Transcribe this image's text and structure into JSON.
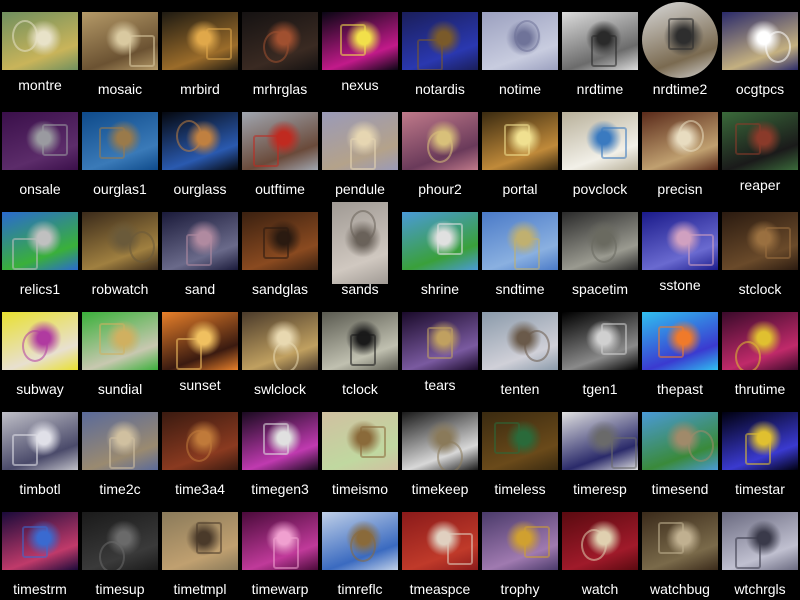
{
  "gallery": {
    "items": [
      {
        "name": "montre",
        "colors": [
          "#6f8f5e",
          "#c9b45a",
          "#e8e2c8"
        ],
        "label_high": true
      },
      {
        "name": "mosaic",
        "colors": [
          "#b59a68",
          "#6b5232",
          "#d9c9a0"
        ]
      },
      {
        "name": "mrbird",
        "colors": [
          "#1e1a12",
          "#9b6c2a",
          "#e0a84a"
        ]
      },
      {
        "name": "mrhrglas",
        "colors": [
          "#151212",
          "#3a2a22",
          "#a05030"
        ]
      },
      {
        "name": "nexus",
        "colors": [
          "#0a0614",
          "#c21a8a",
          "#f2e04a"
        ],
        "label_high": true
      },
      {
        "name": "notardis",
        "colors": [
          "#1a1e5a",
          "#2a38b0",
          "#7a5a2a"
        ]
      },
      {
        "name": "notime",
        "colors": [
          "#9ba0bf",
          "#c8ccdf",
          "#6f7399"
        ]
      },
      {
        "name": "nrdtime",
        "colors": [
          "#dcdcdc",
          "#6b6b6b",
          "#2a2a2a"
        ]
      },
      {
        "name": "nrdtime2",
        "colors": [
          "#d8d8d8",
          "#7a6a50",
          "#2e2e2e"
        ],
        "round": true
      },
      {
        "name": "ocgtpcs",
        "colors": [
          "#2a2a6a",
          "#c4b080",
          "#ffffff"
        ]
      },
      {
        "name": "onsale",
        "colors": [
          "#3a0f4a",
          "#5c2c6a",
          "#9a9aa0"
        ]
      },
      {
        "name": "ourglas1",
        "colors": [
          "#0e4a8a",
          "#3a7ab8",
          "#9a7a4a"
        ]
      },
      {
        "name": "ourglass",
        "colors": [
          "#05080f",
          "#2a5ab0",
          "#c08040"
        ]
      },
      {
        "name": "outftime",
        "colors": [
          "#a0a6b0",
          "#6a4a3a",
          "#c02a20"
        ]
      },
      {
        "name": "pendule",
        "colors": [
          "#9a9ab8",
          "#b4a28a",
          "#e6d6b2"
        ]
      },
      {
        "name": "phour2",
        "colors": [
          "#c07a8a",
          "#6a3a5a",
          "#d8c07a"
        ]
      },
      {
        "name": "portal",
        "colors": [
          "#3a2a10",
          "#c08a3a",
          "#f0e090"
        ]
      },
      {
        "name": "povclock",
        "colors": [
          "#b8b09a",
          "#f2f0e8",
          "#3a7ac0"
        ]
      },
      {
        "name": "precisn",
        "colors": [
          "#5a2a1a",
          "#c0a070",
          "#e8dcc0"
        ]
      },
      {
        "name": "reaper",
        "colors": [
          "#3a6a3a",
          "#1a1a1a",
          "#8a3a2a"
        ],
        "label_high": true
      },
      {
        "name": "relics1",
        "colors": [
          "#2a6ad0",
          "#3ab03a",
          "#c0c0c0"
        ]
      },
      {
        "name": "robwatch",
        "colors": [
          "#3a2a1a",
          "#a08040",
          "#6a5a3a"
        ]
      },
      {
        "name": "sand",
        "colors": [
          "#1a1a3a",
          "#6a6a8a",
          "#b08aa0"
        ]
      },
      {
        "name": "sandglas",
        "colors": [
          "#3a2010",
          "#8a4a20",
          "#2a1a10"
        ]
      },
      {
        "name": "sands",
        "colors": [
          "#a09a94",
          "#d0c8c0",
          "#6a625a"
        ],
        "tall": true
      },
      {
        "name": "shrine",
        "colors": [
          "#4a9ad8",
          "#3aa03a",
          "#e0e0e0"
        ]
      },
      {
        "name": "sndtime",
        "colors": [
          "#4a7ac8",
          "#8ab0e0",
          "#c0b070"
        ]
      },
      {
        "name": "spacetim",
        "colors": [
          "#2a2a2a",
          "#9a9a90",
          "#6a6a60"
        ]
      },
      {
        "name": "sstone",
        "colors": [
          "#1a1a8a",
          "#6a6ad0",
          "#d0a0c0"
        ],
        "label_high": true
      },
      {
        "name": "stclock",
        "colors": [
          "#2a1a10",
          "#6a4a2a",
          "#9a7040"
        ]
      },
      {
        "name": "subway",
        "colors": [
          "#e8e030",
          "#e8e0d0",
          "#b03aa0"
        ]
      },
      {
        "name": "sundial",
        "colors": [
          "#3ab03a",
          "#c8c8b0",
          "#d0b060"
        ]
      },
      {
        "name": "sunset",
        "colors": [
          "#e8802a",
          "#3a1a10",
          "#f0c060"
        ],
        "label_high": true
      },
      {
        "name": "swlclock",
        "colors": [
          "#4a3a2a",
          "#c0a060",
          "#e8d8b0"
        ]
      },
      {
        "name": "tclock",
        "colors": [
          "#5a5a50",
          "#c0c0b0",
          "#1a1a1a"
        ]
      },
      {
        "name": "tears",
        "colors": [
          "#1a0a2a",
          "#7a5aa0",
          "#c0a060"
        ],
        "label_high": true
      },
      {
        "name": "tenten",
        "colors": [
          "#8a9aaa",
          "#d0d0d8",
          "#6a5a4a"
        ]
      },
      {
        "name": "tgen1",
        "colors": [
          "#000000",
          "#8a8a8a",
          "#d0d0d0"
        ]
      },
      {
        "name": "thepast",
        "colors": [
          "#30c0f0",
          "#3a3ad0",
          "#f07a2a"
        ]
      },
      {
        "name": "thrutime",
        "colors": [
          "#3a0a2a",
          "#c02a6a",
          "#e0c030"
        ]
      },
      {
        "name": "timbotl",
        "colors": [
          "#c0c0c8",
          "#4a4a6a",
          "#e0e0e8"
        ]
      },
      {
        "name": "time2c",
        "colors": [
          "#5a6a9a",
          "#9a8a70",
          "#d0c0a0"
        ]
      },
      {
        "name": "time3a4",
        "colors": [
          "#3a1a10",
          "#8a3a20",
          "#c07a3a"
        ]
      },
      {
        "name": "timegen3",
        "colors": [
          "#1a0a20",
          "#c03ab0",
          "#e0e0e0"
        ]
      },
      {
        "name": "timeismo",
        "colors": [
          "#d0c0a0",
          "#c0d8a0",
          "#8a6a3a"
        ]
      },
      {
        "name": "timekeep",
        "colors": [
          "#1a1a1a",
          "#d8d8d8",
          "#8a7a5a"
        ]
      },
      {
        "name": "timeless",
        "colors": [
          "#3a2a10",
          "#6a4a1a",
          "#2a6a3a"
        ]
      },
      {
        "name": "timeresp",
        "colors": [
          "#e0e0e0",
          "#2a2a6a",
          "#6a6a6a"
        ]
      },
      {
        "name": "timesend",
        "colors": [
          "#4a9ad8",
          "#3a8a3a",
          "#a08a6a"
        ]
      },
      {
        "name": "timestar",
        "colors": [
          "#000010",
          "#3a3ad0",
          "#e0c030"
        ]
      },
      {
        "name": "timestrm",
        "colors": [
          "#1a0a3a",
          "#c03a6a",
          "#3a6ad0"
        ]
      },
      {
        "name": "timesup",
        "colors": [
          "#1a1a1a",
          "#3a3a3a",
          "#6a6a6a"
        ]
      },
      {
        "name": "timetmpl",
        "colors": [
          "#8a7a5a",
          "#c0a070",
          "#4a3a2a"
        ]
      },
      {
        "name": "timewarp",
        "colors": [
          "#4a0a3a",
          "#c03a9a",
          "#f0a0d0"
        ]
      },
      {
        "name": "timreflc",
        "colors": [
          "#c0d0e8",
          "#3a6ac0",
          "#8a6a3a"
        ]
      },
      {
        "name": "tmeaspce",
        "colors": [
          "#8a1a1a",
          "#c03a2a",
          "#e0d0c0"
        ]
      },
      {
        "name": "trophy",
        "colors": [
          "#4a3a6a",
          "#a07ab0",
          "#d0a030"
        ]
      },
      {
        "name": "watch",
        "colors": [
          "#5a0a10",
          "#a01a2a",
          "#e0d0b0"
        ]
      },
      {
        "name": "watchbug",
        "colors": [
          "#3a2a1a",
          "#7a6a4a",
          "#c0b090"
        ]
      },
      {
        "name": "wtchrgls",
        "colors": [
          "#6a6a80",
          "#c0c0d0",
          "#3a3a4a"
        ]
      }
    ]
  }
}
